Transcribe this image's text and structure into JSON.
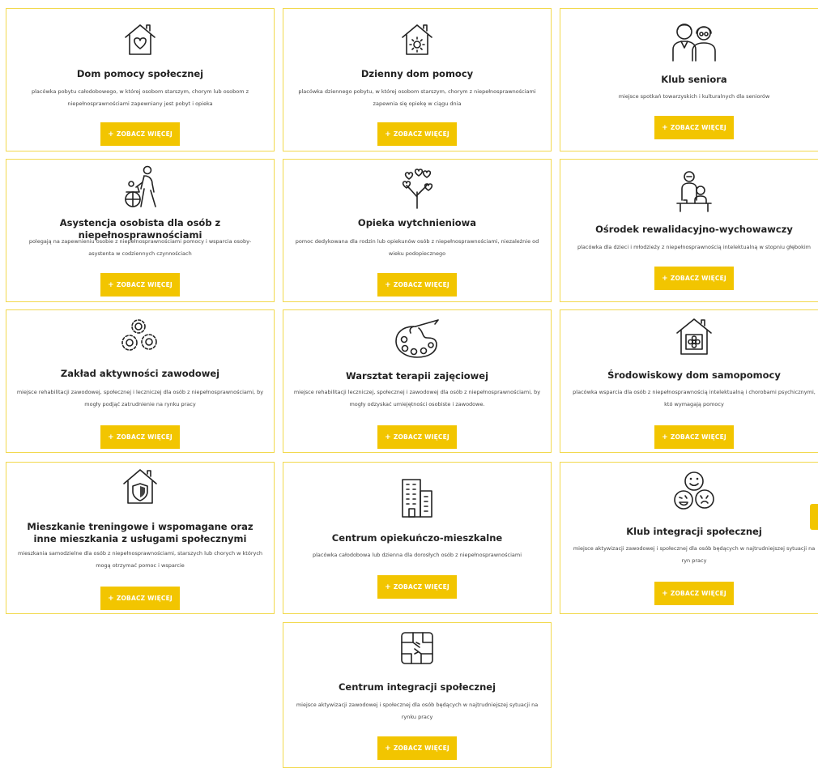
{
  "cta_label": "ZOBACZ WIĘCEJ",
  "colors": {
    "accent": "#f2c500",
    "card_border": "#f2d94e",
    "text": "#222222"
  },
  "cards": [
    {
      "icon": "house-heart-icon",
      "title": "Dom pomocy społecznej",
      "desc": "placówka pobytu całodobowego, w której osobom starszym, chorym lub osobom z niepełnosprawnościami zapewniany jest pobyt i opieka"
    },
    {
      "icon": "house-sun-icon",
      "title": "Dzienny dom pomocy",
      "desc": "placówka dziennego pobytu, w której osobom starszym, chorym z niepełnosprawnościami zapewnia się opiekę w ciągu dnia"
    },
    {
      "icon": "seniors-icon",
      "title": "Klub seniora",
      "desc": "miejsce spotkań towarzyskich i kulturalnych dla seniorów"
    },
    {
      "icon": "wheelchair-assistant-icon",
      "title": "Asystencja osobista dla osób z niepełnosprawnościami",
      "desc": "polegają na zapewnieniu osobie z niepełnosprawnościami pomocy i wsparcia osoby-asystenta w codziennych czynnościach"
    },
    {
      "icon": "heart-tree-icon",
      "title": "Opieka wytchnieniowa",
      "desc": "pomoc dedykowana dla rodzin lub opiekunów osób z niepełnosprawnościami, niezależnie od wieku podopiecznego"
    },
    {
      "icon": "teacher-student-icon",
      "title": "Ośrodek rewalidacyjno-wychowawczy",
      "desc": "placówka dla dzieci i młodzieży z niepełnosprawnością intelektualną w stopniu głębokim"
    },
    {
      "icon": "gears-icon",
      "title": "Zakład aktywności zawodowej",
      "desc": "miejsce rehabilitacji zawodowej, społecznej i leczniczej dla osób z niepełnosprawnościami, by mogły podjąć zatrudnienie na rynku pracy"
    },
    {
      "icon": "palette-icon",
      "title": "Warsztat terapii zajęciowej",
      "desc": "miejsce rehabilitacji leczniczej, społecznej i zawodowej dla osób z niepełnosprawnościami, by mogły odzyskać umiejętności osobiste i zawodowe."
    },
    {
      "icon": "house-flower-icon",
      "title": "Środowiskowy dom samopomocy",
      "desc": "placówka wsparcia dla osób z niepełnosprawnością intelektualną i chorobami psychicznymi, któ wymagają pomocy"
    },
    {
      "icon": "house-shield-icon",
      "title": "Mieszkanie treningowe i wspomagane oraz inne mieszkania z usługami społecznymi",
      "desc": "mieszkania samodzielne dla osób z niepełnosprawnościami, starszych lub chorych w których mogą otrzymać pomoc i wsparcie"
    },
    {
      "icon": "buildings-icon",
      "title": "Centrum opiekuńczo-mieszkalne",
      "desc": "placówka całodobowa lub dzienna dla dorosłych osób z niepełnosprawnościami"
    },
    {
      "icon": "faces-icon",
      "title": "Klub integracji społecznej",
      "desc": "miejsce aktywizacji zawodowej i społecznej dla osób będących w najtrudniejszej sytuacji na ryn pracy"
    },
    {
      "icon": "linked-hands-icon",
      "title": "Centrum integracji społecznej",
      "desc": "miejsce aktywizacji zawodowej i społecznej dla osób będących w najtrudniejszej sytuacji na rynku pracy"
    }
  ]
}
